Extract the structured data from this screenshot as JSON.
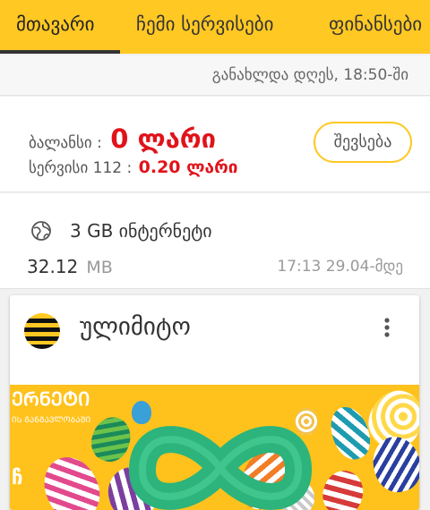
{
  "tabs": [
    {
      "label": "მთავარი",
      "active": true
    },
    {
      "label": "ჩემი სერვისები",
      "active": false
    },
    {
      "label": "ფინანსები",
      "active": false
    }
  ],
  "updated": "განახლდა დღეს, 18:50-ში",
  "balance": {
    "label": "ბალანსი :",
    "value": "0 ლარი",
    "service_label": "სერვისი 112 :",
    "service_value": "0.20 ლარი",
    "topup_label": "შევსება"
  },
  "internet": {
    "icon": "globe-icon",
    "title": "3 GB ინტერნეტი",
    "amount": "32.12",
    "unit": "MB",
    "expiry": "17:13 29.04-მდე"
  },
  "tariff": {
    "name": "ულიმიტო",
    "icon": "brand-logo",
    "menu_icon": "more-vert-icon",
    "banner_title": "ᲔᲠᲜᲔᲢᲘ",
    "banner_subtitle": "ᲘᲡ ᲒᲐᲜᲒᲐᲕᲚᲝᲑᲐᲨᲘ",
    "banner_corner": "ჩ"
  },
  "colors": {
    "brand_yellow": "#ffc823",
    "accent_red": "#e1131a",
    "banner_green": "#2cb47c"
  }
}
